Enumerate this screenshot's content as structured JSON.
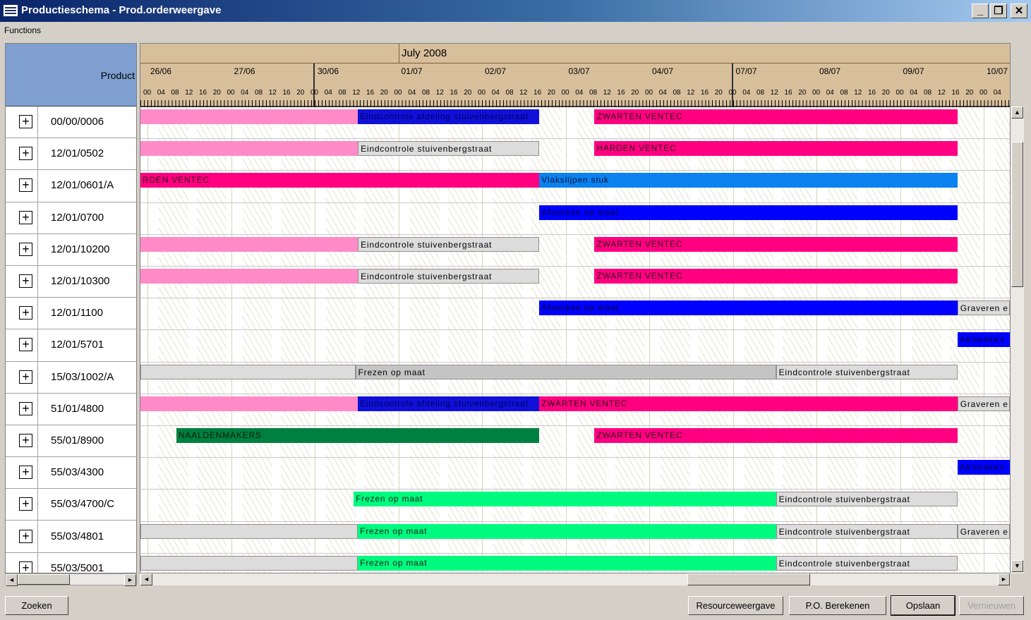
{
  "window": {
    "title": "Productieschema - Prod.orderweergave",
    "controls": {
      "minimize": "_",
      "maximize": "❐",
      "close": "✕"
    }
  },
  "menu": {
    "functions": "Functions"
  },
  "left_panel": {
    "header_label": "Product",
    "expand_symbol": "+",
    "rows": [
      "00/00/0006",
      "12/01/0502",
      "12/01/0601/A",
      "12/01/0700",
      "12/01/10200",
      "12/01/10300",
      "12/01/1100",
      "12/01/5701",
      "15/03/1002/A",
      "51/01/4800",
      "55/01/8900",
      "55/03/4300",
      "55/03/4700/C",
      "55/03/4801",
      "55/03/5001"
    ]
  },
  "timeline": {
    "month": "July 2008",
    "days": [
      "26/06",
      "27/06",
      "30/06",
      "01/07",
      "02/07",
      "03/07",
      "04/07",
      "07/07",
      "08/07",
      "09/07",
      "10/07"
    ],
    "hours": [
      "00",
      "04",
      "08",
      "12",
      "16",
      "20"
    ]
  },
  "tasks": [
    {
      "row": 0,
      "start": 0,
      "end": 2.6,
      "label": "",
      "style": "pink"
    },
    {
      "row": 0,
      "start": 2.6,
      "end": 4.77,
      "label": "Eindcontrole afdeling stuivenbergstraat",
      "style": "navy"
    },
    {
      "row": 0,
      "start": 5.43,
      "end": 9.77,
      "label": "ZWARTEN VENTEC",
      "style": "magenta"
    },
    {
      "row": 1,
      "start": 0,
      "end": 2.6,
      "label": "",
      "style": "pink"
    },
    {
      "row": 1,
      "start": 2.6,
      "end": 4.77,
      "label": "Eindcontrole stuivenbergstraat",
      "style": "grey"
    },
    {
      "row": 1,
      "start": 5.43,
      "end": 9.77,
      "label": "HARDEN VENTEC",
      "style": "magenta"
    },
    {
      "row": 2,
      "start": 0,
      "end": 4.77,
      "label": "RDEN VENTEC",
      "style": "magenta"
    },
    {
      "row": 2,
      "start": 4.77,
      "end": 9.77,
      "label": "Vlakslijpen stuk",
      "style": "azure"
    },
    {
      "row": 3,
      "start": 4.77,
      "end": 9.77,
      "label": "Afwerken op maat",
      "style": "blue"
    },
    {
      "row": 4,
      "start": 0,
      "end": 2.6,
      "label": "",
      "style": "pink"
    },
    {
      "row": 4,
      "start": 2.6,
      "end": 4.77,
      "label": "Eindcontrole stuivenbergstraat",
      "style": "grey"
    },
    {
      "row": 4,
      "start": 5.43,
      "end": 9.77,
      "label": "ZWARTEN VENTEC",
      "style": "magenta"
    },
    {
      "row": 5,
      "start": 0,
      "end": 2.6,
      "label": "",
      "style": "pink"
    },
    {
      "row": 5,
      "start": 2.6,
      "end": 4.77,
      "label": "Eindcontrole stuivenbergstraat",
      "style": "grey"
    },
    {
      "row": 5,
      "start": 5.43,
      "end": 9.77,
      "label": "ZWARTEN VENTEC",
      "style": "magenta"
    },
    {
      "row": 6,
      "start": 4.77,
      "end": 9.77,
      "label": "Afwerken op maat",
      "style": "blue"
    },
    {
      "row": 6,
      "start": 9.77,
      "end": 10.4,
      "label": "Graveren e",
      "style": "grey"
    },
    {
      "row": 7,
      "start": 9.77,
      "end": 10.4,
      "label": "Aanmaken",
      "style": "blue"
    },
    {
      "row": 8,
      "start": 0,
      "end": 2.57,
      "label": "",
      "style": "grey"
    },
    {
      "row": 8,
      "start": 2.57,
      "end": 7.6,
      "label": "Frezen op maat",
      "style": "greydark"
    },
    {
      "row": 8,
      "start": 7.6,
      "end": 9.77,
      "label": "Eindcontrole stuivenbergstraat",
      "style": "grey"
    },
    {
      "row": 9,
      "start": 0,
      "end": 2.6,
      "label": "",
      "style": "pink"
    },
    {
      "row": 9,
      "start": 2.6,
      "end": 4.77,
      "label": "Eindcontrole afdeling stuivenbergstraat",
      "style": "navy"
    },
    {
      "row": 9,
      "start": 4.77,
      "end": 9.77,
      "label": "ZWARTEN VENTEC",
      "style": "magenta"
    },
    {
      "row": 9,
      "start": 9.77,
      "end": 10.4,
      "label": "Graveren e",
      "style": "grey"
    },
    {
      "row": 10,
      "start": 0.43,
      "end": 4.77,
      "label": "NAALDENMAKERS",
      "style": "darkgreen"
    },
    {
      "row": 10,
      "start": 5.43,
      "end": 9.77,
      "label": "ZWARTEN VENTEC",
      "style": "magenta"
    },
    {
      "row": 11,
      "start": 9.77,
      "end": 10.4,
      "label": "Aanmaken",
      "style": "blue"
    },
    {
      "row": 12,
      "start": 2.55,
      "end": 7.6,
      "label": "Frezen op maat",
      "style": "green"
    },
    {
      "row": 12,
      "start": 7.6,
      "end": 9.77,
      "label": "Eindcontrole stuivenbergstraat",
      "style": "grey"
    },
    {
      "row": 13,
      "start": 0,
      "end": 2.6,
      "label": "",
      "style": "grey"
    },
    {
      "row": 13,
      "start": 2.6,
      "end": 7.6,
      "label": "Frezen op maat",
      "style": "green"
    },
    {
      "row": 13,
      "start": 7.6,
      "end": 9.77,
      "label": "Eindcontrole stuivenbergstraat",
      "style": "grey"
    },
    {
      "row": 13,
      "start": 9.77,
      "end": 10.4,
      "label": "Graveren e",
      "style": "grey"
    },
    {
      "row": 14,
      "start": 0,
      "end": 2.6,
      "label": "",
      "style": "grey"
    },
    {
      "row": 14,
      "start": 2.6,
      "end": 7.6,
      "label": "Frezen op maat",
      "style": "green"
    },
    {
      "row": 14,
      "start": 7.6,
      "end": 9.77,
      "label": "Eindcontrole stuivenbergstraat",
      "style": "grey"
    }
  ],
  "buttons": {
    "zoeken": "Zoeken",
    "resourceweergave": "Resourceweergave",
    "po_berekenen": "P.O. Berekenen",
    "opslaan": "Opslaan",
    "vernieuwen": "Vernieuwen"
  }
}
